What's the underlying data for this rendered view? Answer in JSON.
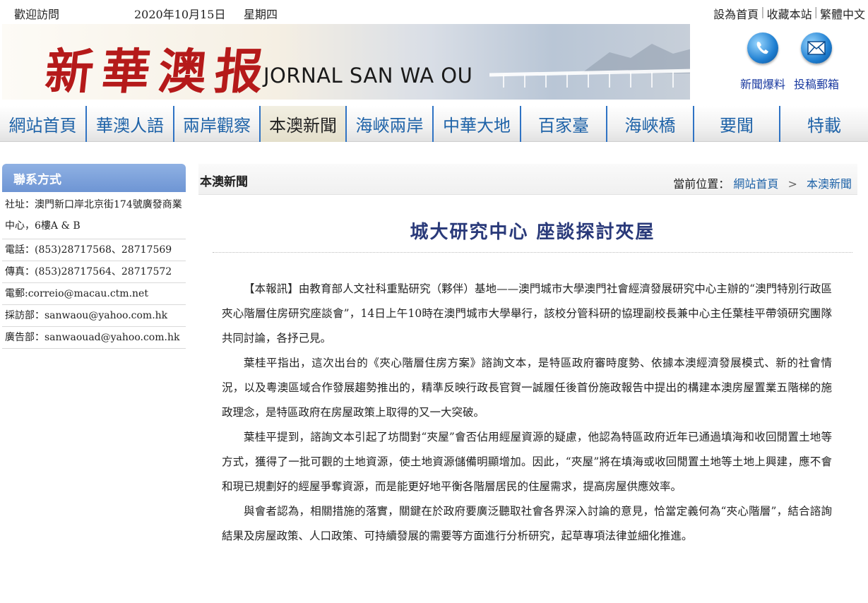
{
  "topbar": {
    "welcome": "歡迎訪問",
    "date": "2020年10月15日",
    "weekday": "星期四",
    "links": [
      "設為首頁",
      "收藏本站",
      "繁體中文"
    ]
  },
  "banner": {
    "logo_cn": "新華澳报",
    "logo_en": "JORNAL SAN WA OU"
  },
  "services": [
    {
      "label": "新聞爆料",
      "icon": "phone-icon"
    },
    {
      "label": "投稿郵箱",
      "icon": "mail-icon"
    }
  ],
  "nav": [
    {
      "label": "網站首頁"
    },
    {
      "label": "華澳人語"
    },
    {
      "label": "兩岸觀察"
    },
    {
      "label": "本澳新聞",
      "active": true
    },
    {
      "label": "海峽兩岸"
    },
    {
      "label": "中華大地"
    },
    {
      "label": "百家臺"
    },
    {
      "label": "海峽橋"
    },
    {
      "label": "要聞"
    },
    {
      "label": "特載"
    }
  ],
  "sidebar": {
    "title": "聯系方式",
    "rows": [
      "社址：澳門新口岸北京街174號廣發商業中心，6樓A & B",
      "電話：(853)28717568、28717569",
      "傳真：(853)28717564、28717572",
      "電郵:correio@macau.ctm.net",
      "採訪部：sanwaou@yahoo.com.hk",
      "廣告部：sanwaouad@yahoo.com.hk"
    ]
  },
  "main": {
    "section": "本澳新聞",
    "breadcrumb": {
      "label": "當前位置：",
      "home": "網站首頁",
      "arrow": ">",
      "current": "本澳新聞"
    },
    "headline": "城大研究中心 座談探討夾屋",
    "paragraphs": [
      "【本報訊】由教育部人文社科重點研究（夥伴）基地——澳門城市大學澳門社會經濟發展研究中心主辦的“澳門特別行政區夾心階層住房研究座談會”，14日上午10時在澳門城市大學舉行，該校分管科研的協理副校長兼中心主任葉桂平帶領研究團隊共同討論，各抒己見。",
      "葉桂平指出，這次出台的《夾心階層住房方案》諮詢文本，是特區政府審時度勢、依據本澳經濟發展模式、新的社會情況，以及粵澳區域合作發展趨勢推出的，精準反映行政長官賀一誠履任後首份施政報告中提出的構建本澳房屋置業五階梯的施政理念，是特區政府在房屋政策上取得的又一大突破。",
      "葉桂平提到，諮詢文本引起了坊間對“夾屋”會否佔用經屋資源的疑慮，他認為特區政府近年已通過填海和收回閒置土地等方式，獲得了一批可觀的土地資源，使土地資源儲備明顯增加。因此，“夾屋”將在填海或收回閒置土地等土地上興建，應不會和現已規劃好的經屋爭奪資源，而是能更好地平衡各階層居民的住屋需求，提高房屋供應效率。",
      "與會者認為，相關措施的落實，關鍵在於政府要廣泛聽取社會各界深入討論的意見，恰當定義何為“夾心階層”，結合諮詢結果及房屋政策、人口政策、可持續發展的需要等方面進行分析研究，起草專項法律並細化推進。"
    ]
  },
  "colors": {
    "nav_text": "#1f63a8",
    "logo_red": "#b51a1a",
    "sidebar_head": "#7a9fd8",
    "headline": "#2a3a7a"
  }
}
